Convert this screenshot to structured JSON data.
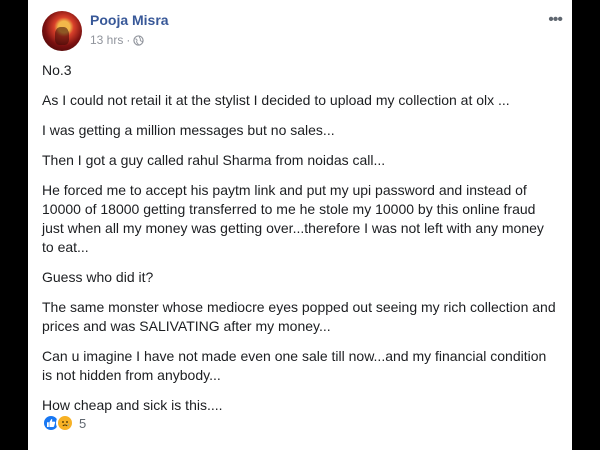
{
  "post": {
    "author": "Pooja Misra",
    "time": "13 hrs",
    "meta_separator": "·",
    "more_label": "•••",
    "paragraphs": [
      "No.3",
      "As I could not retail it at the stylist I decided to upload my collection at olx ...",
      "I was getting a million messages but no sales...",
      "Then I got a guy called rahul Sharma from noidas call...",
      "He forced me to accept his paytm link and put my upi password and instead of 10000 of 18000 getting transferred to me he stole my 10000 by this online fraud just when all my money was getting over...therefore I was not left with any money to eat...",
      "Guess who did it?",
      "The same monster whose mediocre eyes popped out seeing my rich collection and prices and was SALIVATING after my money...",
      "Can u imagine I have not made even one sale till now...and my financial condition is not hidden from anybody...",
      "How cheap and sick is this...."
    ],
    "reactions": {
      "icons": [
        "like-icon",
        "sad-icon"
      ],
      "count": "5"
    }
  },
  "colors": {
    "author_link": "#385898",
    "meta_gray": "#90949c",
    "like_blue": "#1877f2",
    "sad_yellow": "#f7b125"
  }
}
